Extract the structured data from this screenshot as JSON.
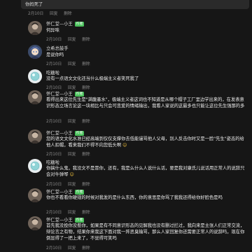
{
  "top": {
    "text": "你妈死了",
    "date": "2月10日",
    "reply_label": "回复",
    "delete_label": "删除"
  },
  "comments": [
    {
      "name": "怀仁堂—小王",
      "badge": "作者",
      "text": "何异味",
      "date": "2月10日",
      "reply_label": "回复",
      "delete_label": "删除",
      "avatar": "portrait-avatar"
    },
    {
      "name": "立希总鼓手",
      "badge": "",
      "text": "是说你吗",
      "date": "2月10日",
      "reply_label": "回复",
      "delete_label": "删除",
      "avatar": "anime-avatar"
    },
    {
      "name": "吃糖啦",
      "badge": "",
      "text": "没有一点语文文化还当什么极端主义者笑死我了",
      "date": "2月10日",
      "reply_label": "回复",
      "delete_label": "删除",
      "avatar": "sphere-avatar"
    },
    {
      "name": "怀仁堂—小王",
      "badge": "作者",
      "text": "看得出来这位先生是\"满腹墨水\"，极端主义者这词也不知道是从哪个帽子工厂里边学出来的，在发表意识形态立场言论这一块相比与只会可悲爱的情绪输出，我看人家说的这最多也只能让这位先生强那的多",
      "date": "2月10日",
      "reply_label": "回复",
      "delete_label": "删除",
      "avatar": "portrait-avatar"
    },
    {
      "name": "怀仁堂—小王",
      "badge": "作者",
      "text": "您的语文文化水准已经高端到仅仅支撑你去低能谩骂他人父母，别人反击你时又是一脸\"先生\"姿态的给他人扣帽，看来我们不得不向您低头啊",
      "date": "2月10日",
      "reply_label": "回复",
      "delete_label": "删除",
      "avatar": "portrait-avatar"
    },
    {
      "name": "吃糖啦",
      "badge": "",
      "text": "你搞什么鬼，我没文不是冒你，还有，我是么什么人说什么话，要是我对康氏儿说话用正常人的说辞只会对牛弹琴",
      "date": "2月10日",
      "reply_label": "回复",
      "delete_label": "删除",
      "avatar": "sphere-avatar"
    },
    {
      "name": "怀仁堂—小王",
      "badge": "作者",
      "text": "你也不看看你硬规的时候对我发的是什么东西，你的意思是你骂了我我还得给你好脸色是吗",
      "date": "2月10日",
      "reply_label": "回复",
      "delete_label": "删除",
      "avatar": "portrait-avatar"
    },
    {
      "name": "怀仁堂—小王",
      "badge": "作者",
      "text": "首先我没投你没惹你，如果是有不同意识形态的见解我也没有删过拦过，我向来是主张人们正常交流，辩论言之有物，结果你来我这下面对我一阵恶臭输骂，那么人家回复你还需要正常人的说辞吗，现在你倒显得了一把上来了，不觉得可笑吗",
      "date": "2月10日",
      "reply_label": "回复",
      "delete_label": "删除",
      "avatar": "portrait-avatar"
    }
  ]
}
